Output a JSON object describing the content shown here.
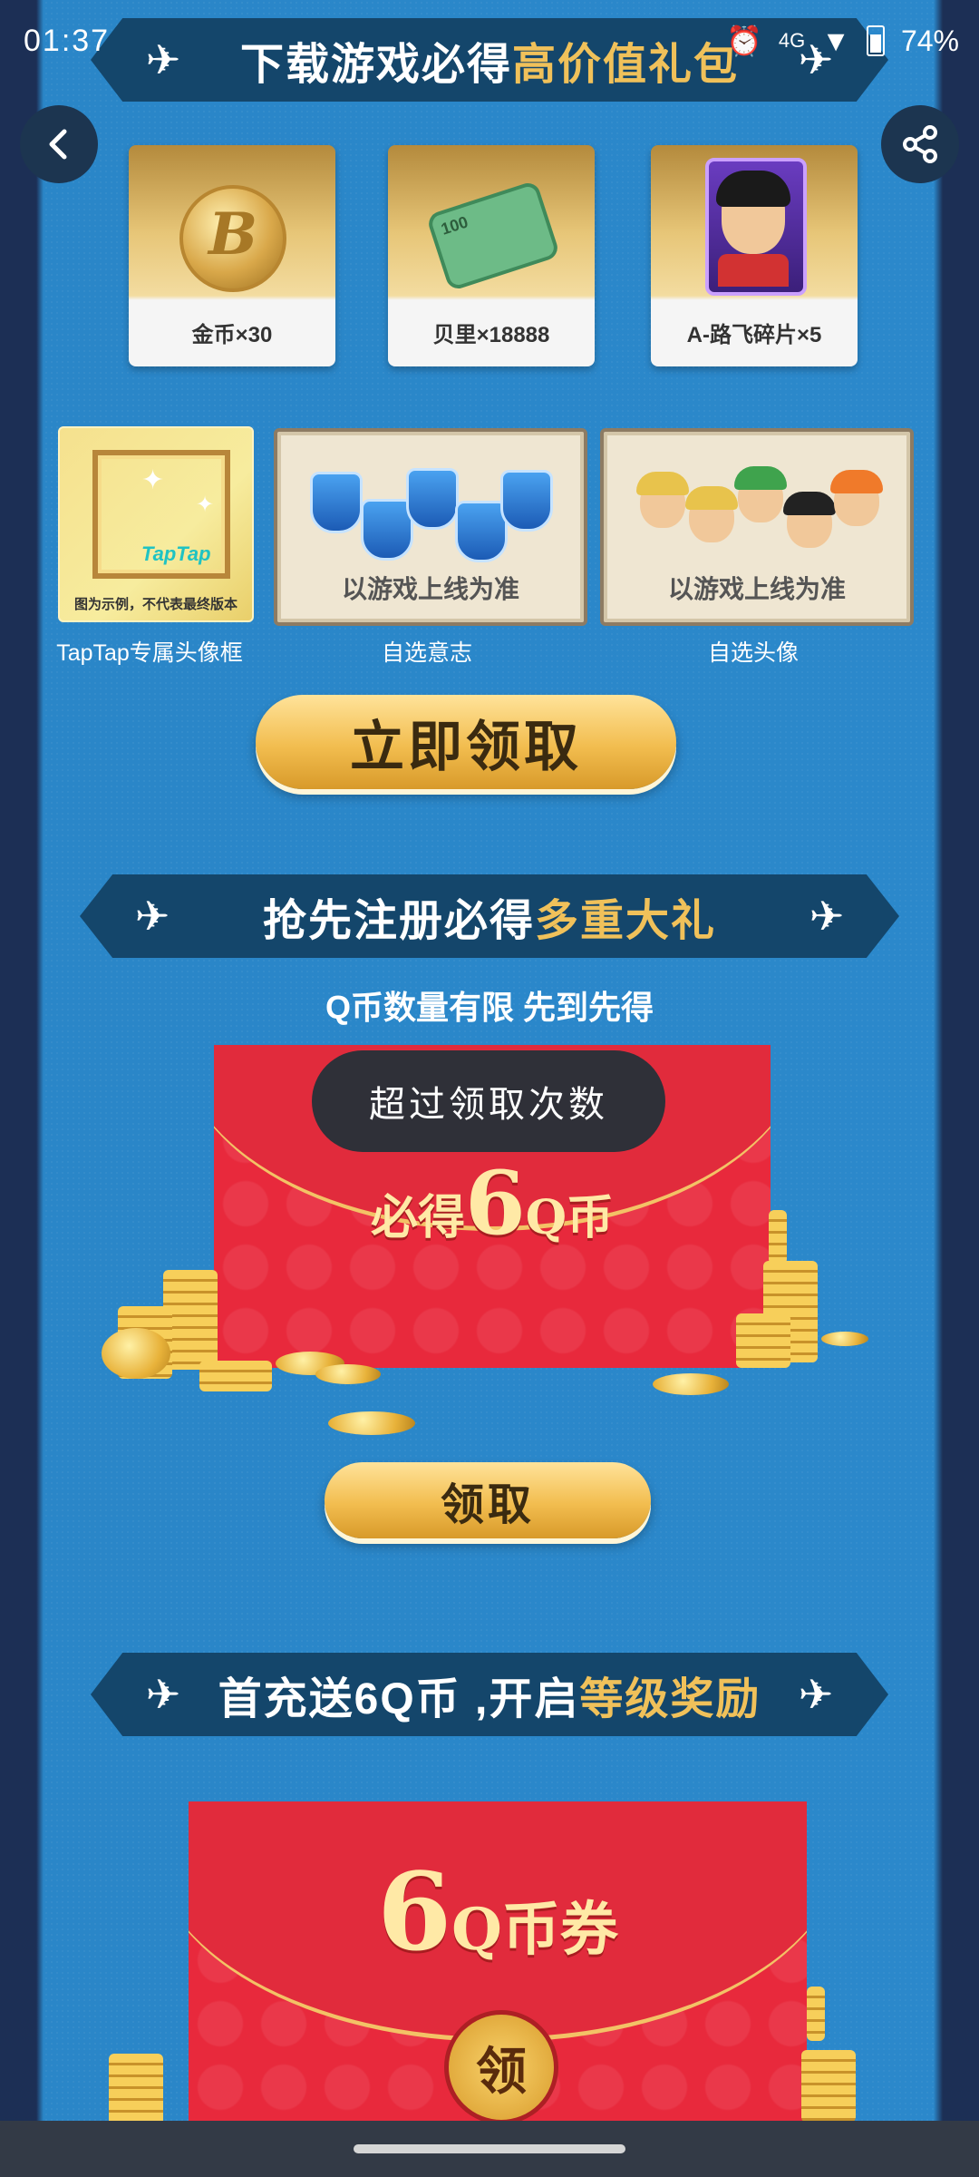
{
  "status_bar": {
    "time": "01:37",
    "network": "4G",
    "battery": "74%"
  },
  "banners": {
    "top": {
      "white": "下载游戏必得",
      "gold": "高价值礼包"
    },
    "register": {
      "white": "抢先注册必得",
      "gold": "多重大礼"
    },
    "recharge": {
      "white": "首充送6Q币 ,开启",
      "gold": "等级奖励"
    }
  },
  "rewards_row1": [
    {
      "label": "金币×30",
      "icon": "gold-coin-icon"
    },
    {
      "label": "贝里×18888",
      "icon": "money-bundle-icon"
    },
    {
      "label": "A-路飞碎片×5",
      "icon": "luffy-card-icon"
    }
  ],
  "rewards_row2": [
    {
      "caption": "TapTap专属头像框",
      "brand": "TapTap",
      "note": "图为示例，不代表最终版本"
    },
    {
      "caption": "自选意志",
      "placeholder": "以游戏上线为准"
    },
    {
      "caption": "自选头像",
      "placeholder": "以游戏上线为准"
    }
  ],
  "claim_now_label": "立即领取",
  "register_subtitle": "Q币数量有限 先到先得",
  "envelope1": {
    "prefix": "必得",
    "amount": "6",
    "unit": "Q币"
  },
  "toast": "超过领取次数",
  "claim_label": "领取",
  "envelope2": {
    "amount": "6",
    "unit": "Q币券",
    "stamp": "领"
  },
  "icons": {
    "back": "back-arrow-icon",
    "share": "share-icon",
    "wing": "wing-emblem-icon"
  },
  "colors": {
    "background": "#2b88cb",
    "banner": "#14466b",
    "gold_text": "#f0c15a",
    "envelope_red": "#e8293c"
  }
}
